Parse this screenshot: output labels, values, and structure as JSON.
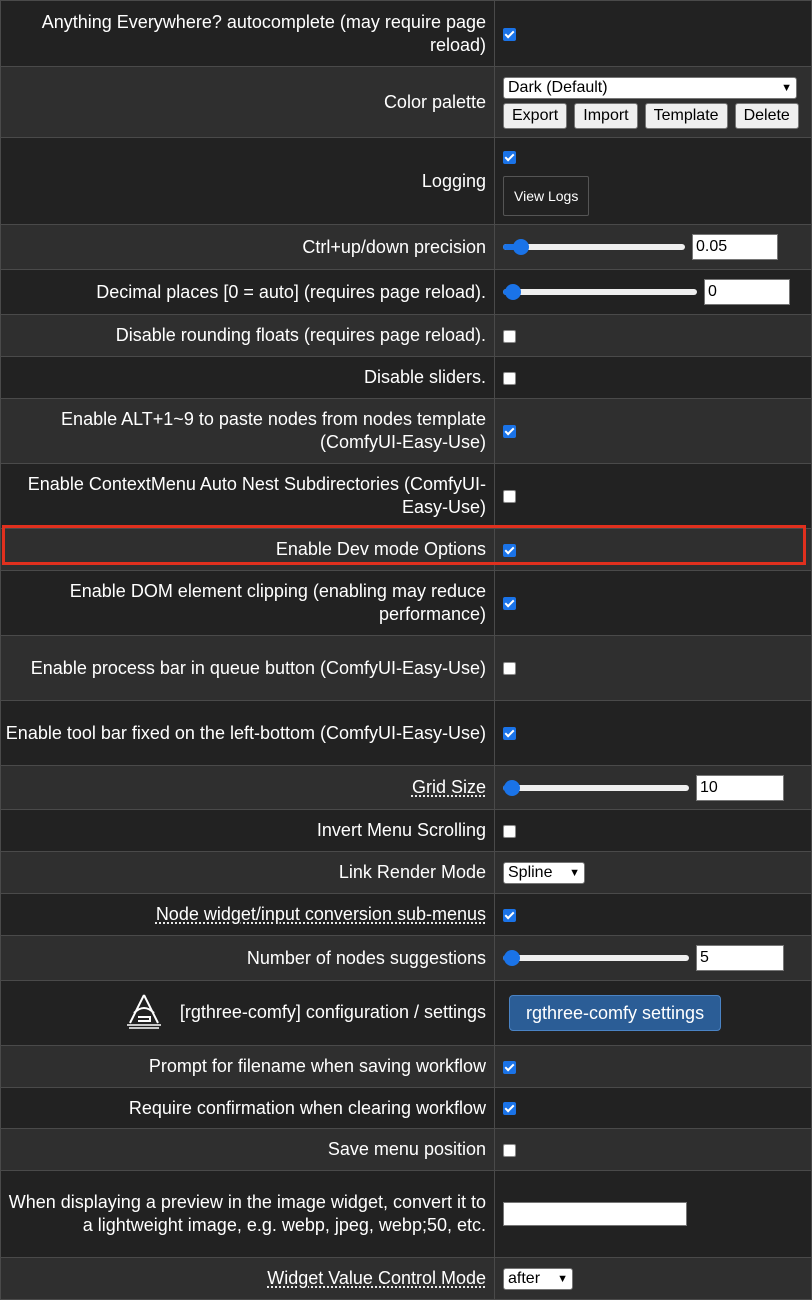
{
  "settings": {
    "anything_everywhere": {
      "label": "Anything Everywhere? autocomplete (may require page reload)",
      "checked": true
    },
    "color_palette": {
      "label": "Color palette",
      "selected": "Dark (Default)",
      "buttons": [
        "Export",
        "Import",
        "Template",
        "Delete"
      ]
    },
    "logging": {
      "label": "Logging",
      "checked": true,
      "button": "View Logs"
    },
    "ctrl_precision": {
      "label": "Ctrl+up/down precision",
      "value": "0.05",
      "slider_fraction": 0.1
    },
    "decimal_places": {
      "label": "Decimal places [0 = auto] (requires page reload).",
      "value": "0",
      "slider_fraction": 0.0
    },
    "disable_rounding": {
      "label": "Disable rounding floats (requires page reload).",
      "checked": false
    },
    "disable_sliders": {
      "label": "Disable sliders.",
      "checked": false
    },
    "alt_paste": {
      "label": "Enable ALT+1~9 to paste nodes from nodes template (ComfyUI-Easy-Use)",
      "checked": true
    },
    "contextmenu_nest": {
      "label": "Enable ContextMenu Auto Nest Subdirectories (ComfyUI-Easy-Use)",
      "checked": false
    },
    "dev_mode": {
      "label": "Enable Dev mode Options",
      "checked": true
    },
    "dom_clipping": {
      "label": "Enable DOM element clipping (enabling may reduce performance)",
      "checked": true
    },
    "process_bar": {
      "label": "Enable process bar in queue button (ComfyUI-Easy-Use)",
      "checked": false
    },
    "tool_bar": {
      "label": "Enable tool bar fixed on the left-bottom (ComfyUI-Easy-Use)",
      "checked": true
    },
    "grid_size": {
      "label": "Grid Size",
      "value": "10",
      "slider_fraction": 0.02
    },
    "invert_menu": {
      "label": "Invert Menu Scrolling",
      "checked": false
    },
    "link_render": {
      "label": "Link Render Mode",
      "selected": "Spline"
    },
    "node_widget": {
      "label": "Node widget/input conversion sub-menus",
      "checked": true
    },
    "node_suggestions": {
      "label": "Number of nodes suggestions",
      "value": "5",
      "slider_fraction": 0.03
    },
    "rgthree": {
      "label": "[rgthree-comfy] configuration / settings",
      "button": "rgthree-comfy settings"
    },
    "prompt_filename": {
      "label": "Prompt for filename when saving workflow",
      "checked": true
    },
    "confirm_clear": {
      "label": "Require confirmation when clearing workflow",
      "checked": true
    },
    "save_menu_pos": {
      "label": "Save menu position",
      "checked": false
    },
    "preview_format": {
      "label": "When displaying a preview in the image widget, convert it to a lightweight image, e.g. webp, jpeg, webp;50, etc.",
      "value": ""
    },
    "widget_control": {
      "label": "Widget Value Control Mode",
      "selected": "after"
    }
  },
  "colors": {
    "accent": "#1a73e8",
    "highlight": "#e0301e",
    "rgthree_button": "#2b5d96"
  }
}
